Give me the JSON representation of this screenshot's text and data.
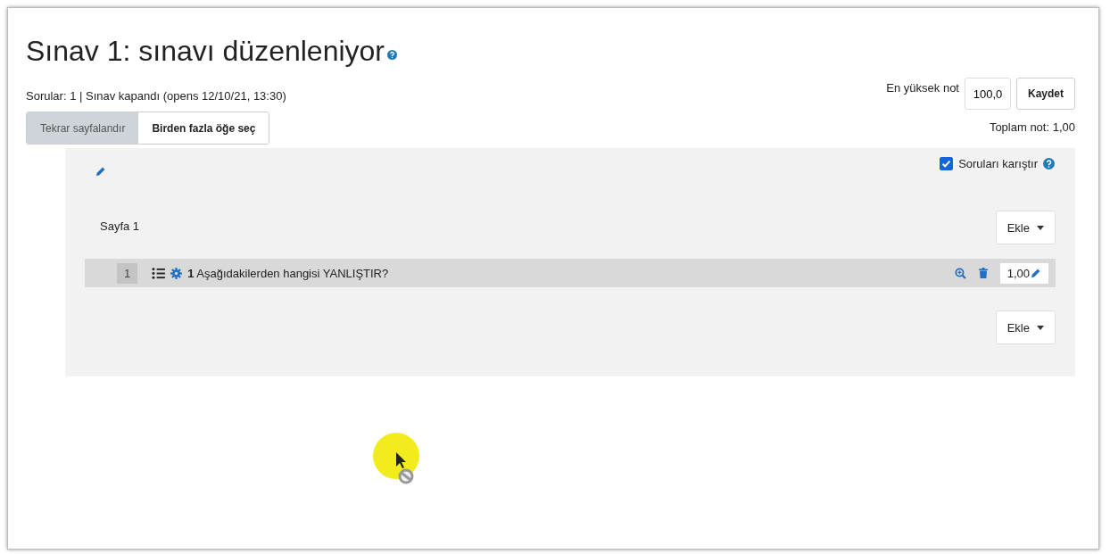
{
  "title": "Sınav 1: sınavı düzenleniyor",
  "info": "Sorular: 1 | Sınav kapandı (opens 12/10/21, 13:30)",
  "max_grade": {
    "label": "En yüksek not",
    "value": "100,0",
    "button": "Kaydet"
  },
  "actions": [
    {
      "label": "Tekrar sayfalandır",
      "disabled": true
    },
    {
      "label": "Birden fazla öğe seç",
      "disabled": false
    }
  ],
  "total": "Toplam not: 1,00",
  "shuffle": {
    "label": "Soruları karıştır",
    "checked": true
  },
  "page": {
    "label": "Sayfa 1",
    "add_button": "Ekle",
    "slots": [
      {
        "slot": "1",
        "number": "1",
        "text": "Aşağıdakilerden hangisi YANLIŞTIR?",
        "mark": "1,00"
      }
    ],
    "add_button_bottom": "Ekle"
  }
}
